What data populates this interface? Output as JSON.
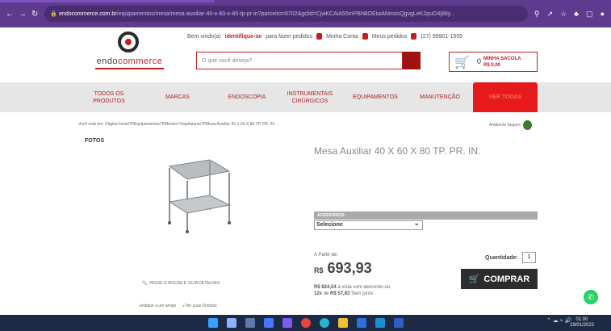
{
  "browser": {
    "nav_icons": [
      "back-icon",
      "forward-icon",
      "reload-icon"
    ],
    "url_domain": "endocommerce.com.br",
    "url_path": "/equipamentos/mesa/mesa-auxiliar-40-x-60-x-80-tp-pr-in?parceiro=8702&gclid=CjwKCAiA55mPBhBOEiwANmzoQgvgLeK2puO4j88y...",
    "action_icons": [
      "search-icon",
      "share-icon",
      "star-icon",
      "extension-icon",
      "sidebar-icon",
      "profile-icon"
    ]
  },
  "header": {
    "logo_text_a": "endo",
    "logo_text_b": "commerce",
    "welcome": "Bem vindo(a)",
    "identify": "identifique-se",
    "welcome_suffix": "para fazer pedidos",
    "account": "Minha Conta",
    "orders": "Meus pedidos",
    "phone": "(27) 99901-1555",
    "search_placeholder": "O que você deseja?",
    "cart_count": "0",
    "cart_title": "MINHA SACOLA",
    "cart_total": "R$ 0,00"
  },
  "menu": {
    "items": [
      "TODOS OS PRODUTOS",
      "MARCAS",
      "ENDOSCOPIA",
      "INSTRUMENTAIS CIRÚRGICOS",
      "EQUIPAMENTOS",
      "MANUTENÇÃO",
      "VER TODAS"
    ]
  },
  "page": {
    "breadcrumb": "Você está em: Página Inicial?PEquipamentos?PMóveis Hospitalares?PMesa Auxiliar 40 X 60 X 80 TP. PR. IN.",
    "secure": "Ambiente Seguro",
    "fotos": "FOTOS",
    "title": "Mesa Auxiliar 40 X 60 X 80 TP. PR. IN.",
    "zoom_hint": "PASSE O MOUSE E VEJA DETALHES",
    "link_indique": "Indique a um amigo",
    "link_duvidas": "Tire suas Dúvidas",
    "acc_head": "ACESSÓRIOS:",
    "acc_select": "Selecione",
    "apartir": "A Partir de:",
    "currency": "R$",
    "price": "693,93",
    "discount_price": "R$ 624,54",
    "discount_text": "à vista com desconto ou",
    "installments": "12x",
    "installments_text": "de",
    "installment_value": "R$ 57,83",
    "installment_suffix": "Sem juros",
    "qty_label": "Quantidade:",
    "qty_value": "1",
    "buy_label": "COMPRAR"
  },
  "taskbar": {
    "time": "01:00",
    "date": "19/01/2022"
  },
  "colors": {
    "accent": "#c51e1e",
    "browser": "#5f3b8f",
    "menu_active": "#e61a1a"
  }
}
